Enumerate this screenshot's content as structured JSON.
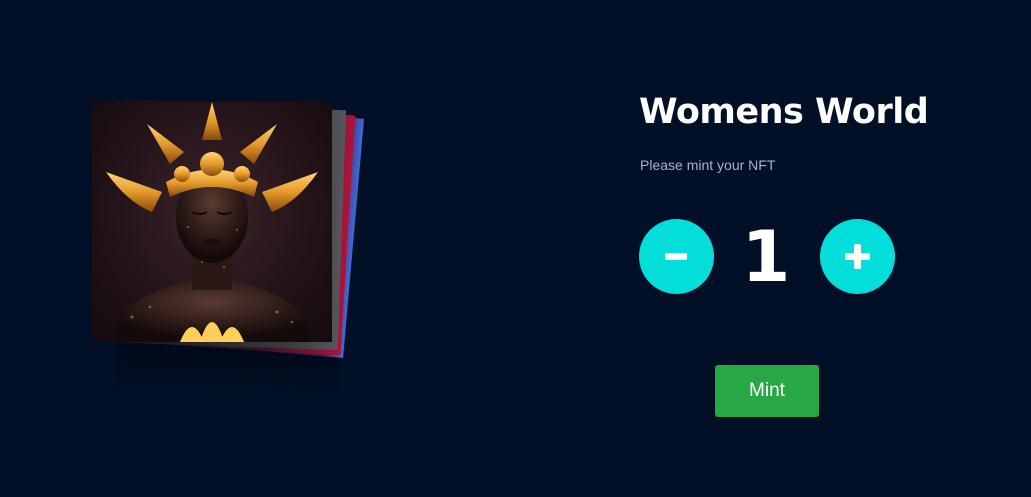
{
  "collection": {
    "title": "Womens World",
    "subtitle": "Please mint your NFT"
  },
  "quantity": {
    "value": "1",
    "decrement_icon": "minus-icon",
    "increment_icon": "plus-icon"
  },
  "mint": {
    "label": "Mint"
  },
  "colors": {
    "background": "#011026",
    "accent": "#04dedb",
    "mint_button": "#28a745",
    "subtitle_text": "#a9b2c2"
  }
}
